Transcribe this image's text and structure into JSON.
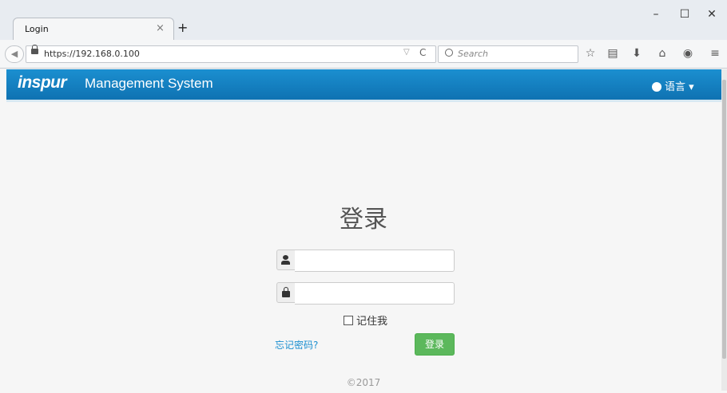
{
  "browser": {
    "tab_title": "Login",
    "tab_close": "×",
    "new_tab": "+",
    "window_buttons": {
      "minimize": "–",
      "maximize": "☐",
      "close": "✕"
    },
    "url": "https://192.168.0.100",
    "search_placeholder": "Search",
    "toolbar_icons": [
      "star-icon",
      "reading-list-icon",
      "download-icon",
      "home-icon",
      "chat-icon",
      "menu-icon"
    ]
  },
  "app": {
    "logo": "inspur",
    "system_name": "Management System",
    "language_label": "语言"
  },
  "login": {
    "title": "登录",
    "username_value": "",
    "password_value": "",
    "remember_label": "记住我",
    "forgot_label": "忘记密码?",
    "submit_label": "登录"
  },
  "footer": {
    "copyright": "©2017"
  },
  "colors": {
    "header": "#1b8fd0",
    "button": "#5cb85c",
    "link": "#1b8fd0"
  }
}
